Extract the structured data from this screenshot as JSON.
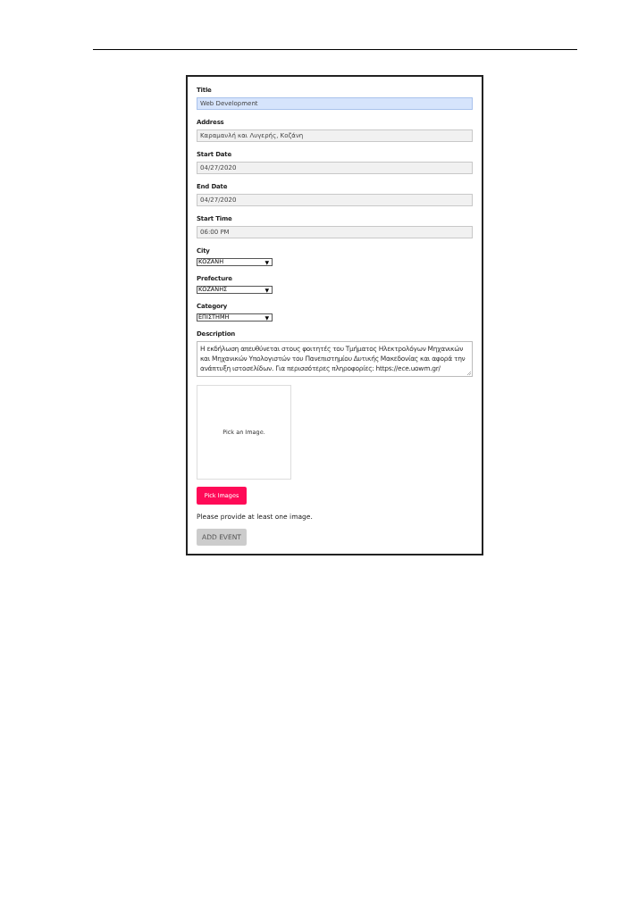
{
  "fields": [
    {
      "kind": "text",
      "label": "Title",
      "value": "Web Development",
      "highlighted": true
    },
    {
      "kind": "text",
      "label": "Address",
      "value": "Καραμανλή και Λυγερής, Κοζάνη",
      "highlighted": false
    },
    {
      "kind": "text",
      "label": "Start Date",
      "value": "04/27/2020",
      "highlighted": false
    },
    {
      "kind": "text",
      "label": "End Date",
      "value": "04/27/2020",
      "highlighted": false
    },
    {
      "kind": "text",
      "label": "Start Time",
      "value": "06:00 PM",
      "highlighted": false
    },
    {
      "kind": "select",
      "label": "City",
      "value": "ΚΟΖΑΝΗ",
      "arrow": "▼"
    },
    {
      "kind": "select",
      "label": "Prefecture",
      "value": "ΚΟΖΑΝΗΣ",
      "arrow": "▼"
    },
    {
      "kind": "select",
      "label": "Category",
      "value": "ΕΠΙΣΤΗΜΗ",
      "arrow": "▼"
    },
    {
      "kind": "textarea",
      "label": "Description",
      "value": "Η εκδήλωση απευθύνεται στους φοιτητές του Τμήματος Ηλεκτρολόγων Μηχανικών και Μηχανικών Υπολογιστών του Πανεπιστημίου Δυτικής Μακεδονίας και αφορά την ανάπτυξη ιστοσελίδων. Για περισσότερες πληροφορίες: https://ece.uowm.gr/"
    }
  ],
  "image_picker": {
    "placeholder": "Pick an Image.",
    "button": "Pick Images"
  },
  "message": "Please provide at least one image.",
  "submit": {
    "label": "ADD EVENT",
    "disabled": true
  }
}
